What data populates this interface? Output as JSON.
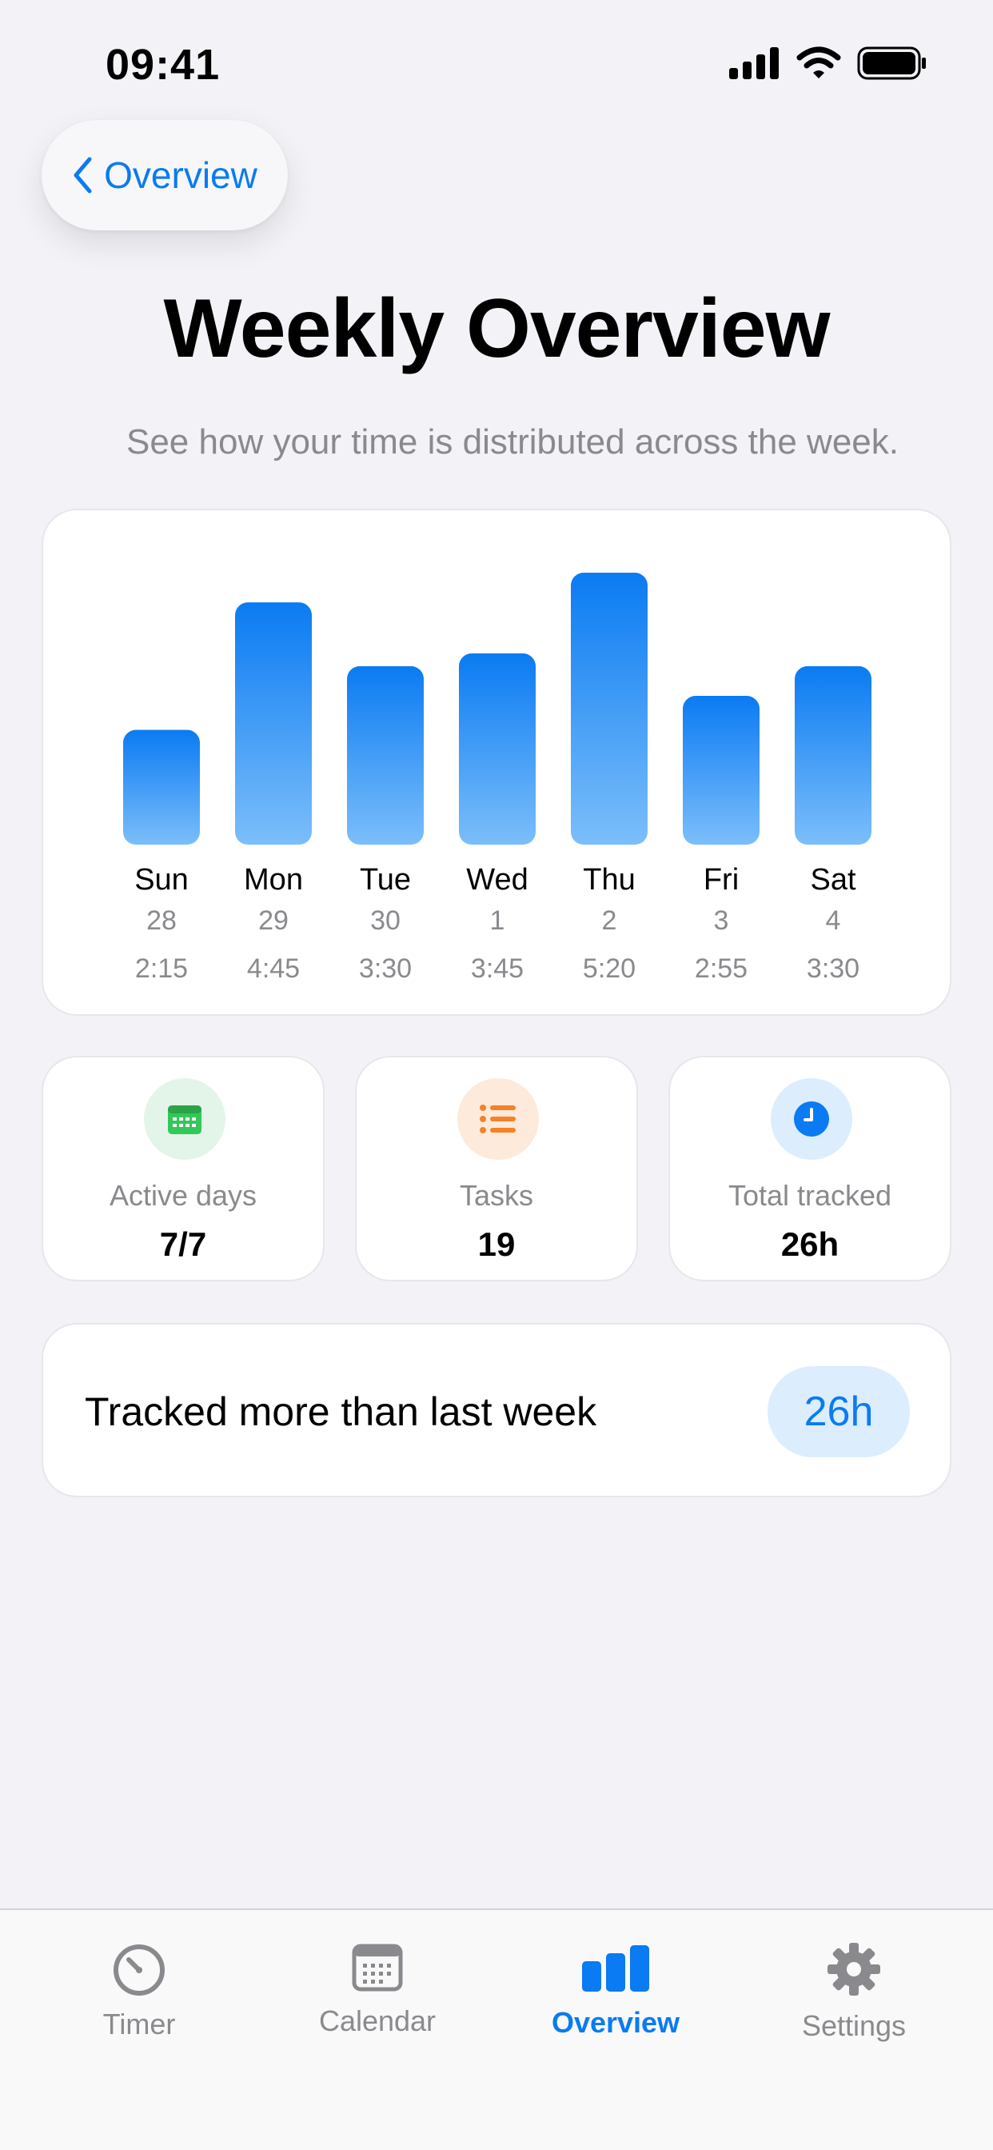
{
  "status_bar": {
    "time": "09:41"
  },
  "header": {
    "back_label": "Overview",
    "title": "Weekly Overview",
    "subtitle": "See how your time is distributed across the week."
  },
  "chart_data": {
    "type": "bar",
    "categories": [
      "Sun",
      "Mon",
      "Tue",
      "Wed",
      "Thu",
      "Fri",
      "Sat"
    ],
    "dates": [
      "28",
      "29",
      "30",
      "1",
      "2",
      "3",
      "4"
    ],
    "time_labels": [
      "2:15",
      "4:45",
      "3:30",
      "3:45",
      "5:20",
      "2:55",
      "3:30"
    ],
    "values": [
      2.25,
      4.75,
      3.5,
      3.75,
      5.333,
      2.917,
      3.5
    ],
    "unit": "hours",
    "grid": false,
    "colors": {
      "bar_top": "#0a7bf2",
      "bar_bottom": "#7bbefa"
    }
  },
  "stats": [
    {
      "label": "Active days",
      "value": "7/7",
      "icon": "calendar-icon",
      "icon_bg": "#e3f5e8",
      "icon_color": "#34c759"
    },
    {
      "label": "Tasks",
      "value": "19",
      "icon": "list-icon",
      "icon_bg": "#fdeadb",
      "icon_color": "#f5822a"
    },
    {
      "label": "Total tracked",
      "value": "26h",
      "icon": "clock-icon",
      "icon_bg": "#dcedfd",
      "icon_color": "#0a7bf2"
    }
  ],
  "comparison": {
    "text": "Tracked more than last week",
    "badge": "26h"
  },
  "tab_bar": {
    "items": [
      {
        "label": "Timer",
        "icon": "timer-icon",
        "active": false
      },
      {
        "label": "Calendar",
        "icon": "calendar-icon",
        "active": false
      },
      {
        "label": "Overview",
        "icon": "bar-chart-icon",
        "active": true
      },
      {
        "label": "Settings",
        "icon": "gear-icon",
        "active": false
      }
    ]
  },
  "colors": {
    "accent": "#0a7bf2",
    "background": "#f2f2f7",
    "secondary_text": "#8a8a8e"
  }
}
